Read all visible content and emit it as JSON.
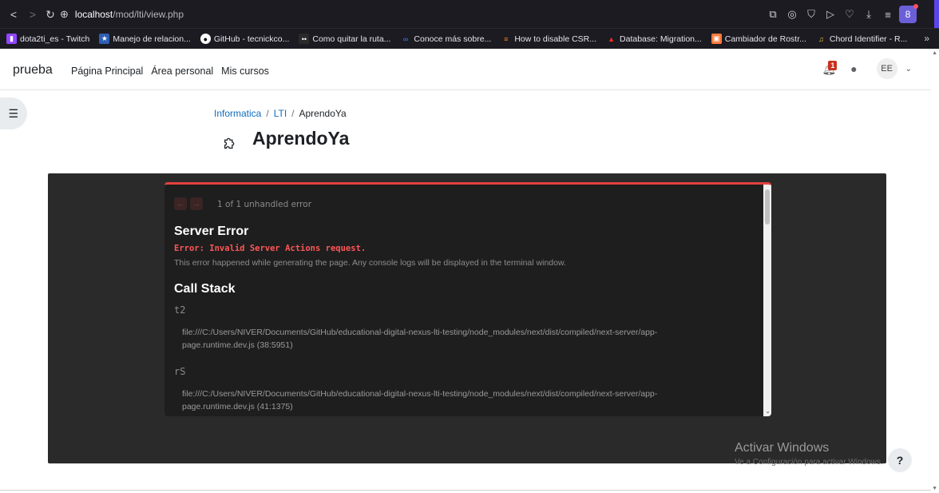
{
  "browser": {
    "url_host": "localhost",
    "url_path": "/mod/lti/view.php",
    "profile_initial": "8",
    "bookmarks": [
      {
        "label": "dota2ti_es - Twitch",
        "color": "#9146ff",
        "glyph": "▮"
      },
      {
        "label": "Manejo de relacion...",
        "color": "#2f5fb3",
        "glyph": "★"
      },
      {
        "label": "GitHub - tecnickco...",
        "color": "#ffffff",
        "glyph": "●"
      },
      {
        "label": "Como quitar la ruta...",
        "color": "#2a2a2a",
        "glyph": "••"
      },
      {
        "label": "Conoce más sobre...",
        "color": "#1c1b22",
        "glyph": "∞"
      },
      {
        "label": "How to disable CSR...",
        "color": "#f48024",
        "glyph": "≡"
      },
      {
        "label": "Database: Migration...",
        "color": "#ff2d20",
        "glyph": "▲"
      },
      {
        "label": "Cambiador de Rostr...",
        "color": "#ff7a3d",
        "glyph": "▣"
      },
      {
        "label": "Chord Identifier - R...",
        "color": "#f4d03f",
        "glyph": "♫"
      }
    ]
  },
  "navbar": {
    "site_name": "prueba",
    "links": [
      "Página Principal",
      "Área personal",
      "Mis cursos"
    ],
    "notification_count": "1",
    "avatar_initials": "EE"
  },
  "breadcrumb": {
    "items": [
      "Informatica",
      "LTI",
      "AprendoYa"
    ],
    "separator": "/"
  },
  "page_title": "AprendoYa",
  "error_overlay": {
    "count_text": "1 of 1 unhandled error",
    "title": "Server Error",
    "message": "Error: Invalid Server Actions request.",
    "description": "This error happened while generating the page. Any console logs will be displayed in the terminal window.",
    "call_stack_title": "Call Stack",
    "frames": [
      {
        "name": "t2",
        "path": "file:///C:/Users/NIVER/Documents/GitHub/educational-digital-nexus-lti-testing/node_modules/next/dist/compiled/next-server/app-page.runtime.dev.js (38:5951)"
      },
      {
        "name": "rS",
        "path": "file:///C:/Users/NIVER/Documents/GitHub/educational-digital-nexus-lti-testing/node_modules/next/dist/compiled/next-server/app-page.runtime.dev.js (41:1375)"
      }
    ]
  },
  "watermark": {
    "title": "Activar Windows",
    "subtitle": "Ve a Configuración para activar Windows."
  },
  "help_label": "?",
  "colors": {
    "error_accent": "#e3413d",
    "link": "#0f6cbf",
    "badge": "#ca3120"
  }
}
